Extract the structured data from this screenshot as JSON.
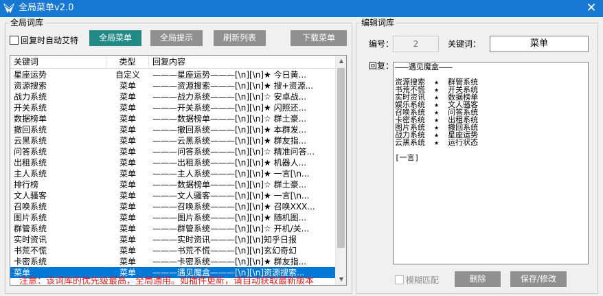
{
  "window": {
    "title": "全局菜单v2.0",
    "close_glyph": "✕"
  },
  "left_panel": {
    "group_title": "全局词库",
    "auto_at_label": "回复时自动艾特",
    "buttons": {
      "global_menu": "全局菜单",
      "global_hint": "全局提示",
      "refresh_list": "刷新列表",
      "download_menu": "下载菜单"
    },
    "table": {
      "headers": [
        "关键词",
        "类型",
        "回复内容"
      ],
      "rows": [
        [
          "星座运势",
          "自定义",
          "———星座运势———[\\n][\\n]★ 今日黄..."
        ],
        [
          "资源搜索",
          "菜单",
          "———资源搜索———[\\n][\\n]★ 搜+资源..."
        ],
        [
          "战力系统",
          "菜单",
          "———战力系统———[\\n][\\n]☆ 安卓战..."
        ],
        [
          "开关系统",
          "菜单",
          "———开关系统———[\\n][\\n]★ 闪照还..."
        ],
        [
          "数据榜单",
          "菜单",
          "———数据榜单———[\\n][\\n]☆ 群土豪..."
        ],
        [
          "撤回系统",
          "菜单",
          "———撤回系统———[\\n][\\n]★ 本群发..."
        ],
        [
          "云黑系统",
          "菜单",
          "———云黑系统———[\\n][\\n]★ 群友指..."
        ],
        [
          "问答系统",
          "菜单",
          "———问答系统———[\\n][\\n]☆ 精准问答..."
        ],
        [
          "出租系统",
          "菜单",
          "———出租系统———[\\n][\\n]★ 机器人..."
        ],
        [
          "主人系统",
          "菜单",
          "———主人系统———[\\n][\\n]★ 一言[\\n..."
        ],
        [
          "排行榜",
          "菜单",
          "———数据榜单———[\\n][\\n]☆ 群土豪..."
        ],
        [
          "文人骚客",
          "菜单",
          "———文人骚客———[\\n][\\n]★ 一言[\\n..."
        ],
        [
          "召唤系统",
          "菜单",
          "———召唤系统———[\\n][\\n]★ 召唤XXX..."
        ],
        [
          "图片系统",
          "菜单",
          "———图片系统———[\\n][\\n]★ 随机图..."
        ],
        [
          "群管系统",
          "菜单",
          "———群管系统———[\\n][\\n]☆ 开机/关..."
        ],
        [
          "实时资讯",
          "菜单",
          "———实时资讯———[\\n][\\n]知乎日报"
        ],
        [
          "书荒不慌",
          "菜单",
          "———书荒不慌———[\\n][\\n]玄幻奇幻"
        ],
        [
          "卡密系统",
          "菜单",
          "———卡密系统———[\\n][\\n]★ 群友指..."
        ],
        [
          "菜单",
          "菜单",
          "———遇见魔盒———[\\n][\\n]资源搜索..."
        ]
      ],
      "selected_row": 18
    },
    "notice": "注意：该词库的优先级最高，全局通用。如插件更新，请自动获取最新版本"
  },
  "right_panel": {
    "group_title": "编辑词库",
    "id_label": "编号：",
    "id_value": "2",
    "keyword_label": "关键词：",
    "keyword_value": "菜单",
    "reply_label": "回复：",
    "reply_value": "———遇见魔盒———\n\n资源搜索  ★  群管系统\n书荒不慌  ★  开关系统\n实时资讯  ★  数据榜单\n娱乐系统  ★  文人骚客\n召唤系统  ★  问答系统\n卡密系统  ★  出租系统\n图片系统  ★  撤回系统\n战力系统  ★  星座运势\n云黑系统  ★  运行状态\n\n[一言]",
    "fuzzy_label": "模糊匹配",
    "buttons": {
      "delete": "删除",
      "save": "保存/修改"
    }
  },
  "colors": {
    "titlebar": "#1778d4",
    "primary_button": "#218a87",
    "secondary_button": "#909090",
    "selection": "#0078d7",
    "notice": "#e02020"
  }
}
